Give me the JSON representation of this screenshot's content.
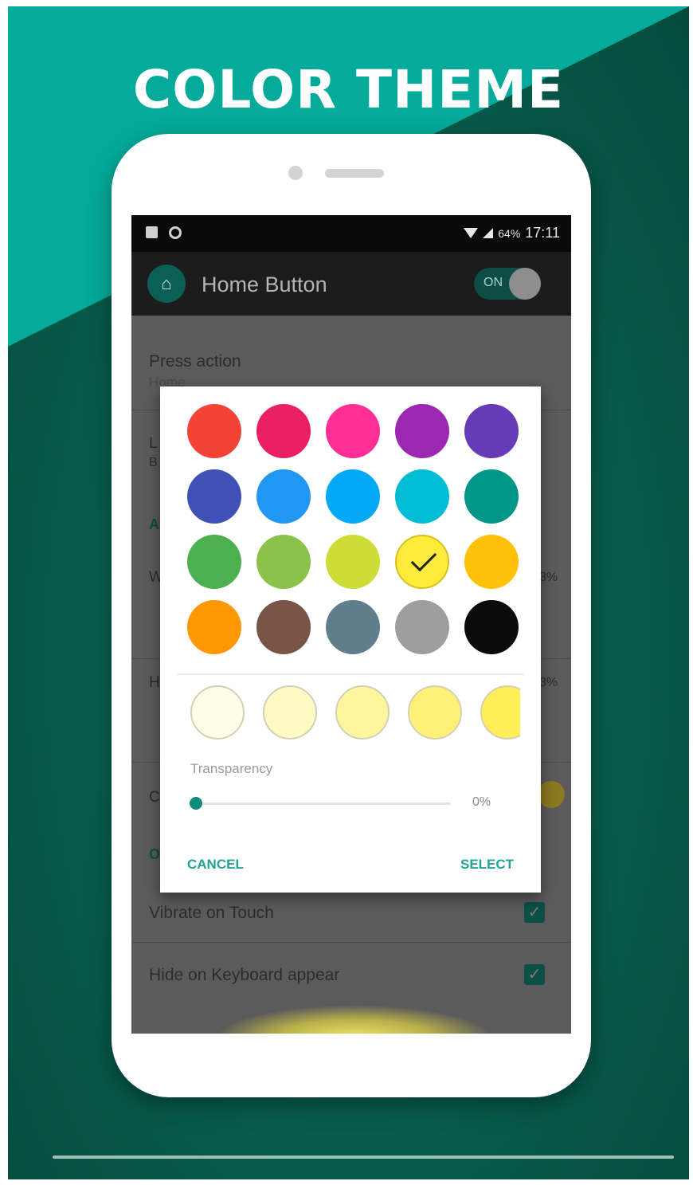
{
  "banner": {
    "title": "COLOR THEME"
  },
  "status_bar": {
    "battery": "64%",
    "time": "17:11"
  },
  "app_bar": {
    "title": "Home Button",
    "toggle_label": "ON",
    "toggle_on": true
  },
  "settings_background": {
    "press_action_label": "Press action",
    "press_action_value": "Home",
    "vibrate_label": "Vibrate on Touch",
    "vibrate_checked": true,
    "hide_keyboard_label": "Hide on Keyboard appear",
    "hide_keyboard_checked": true,
    "fragments": {
      "row2_letter": "L",
      "row2_sub_letter": "B",
      "section_letter": "A",
      "row3_letter": "W",
      "row3_value": "3%",
      "row4_letter": "H",
      "row4_value": "3%",
      "row5_letter": "C",
      "section2_letter": "O"
    }
  },
  "color_picker": {
    "palette": [
      "#f44336",
      "#e91e63",
      "#ff2d96",
      "#9c27b0",
      "#673ab7",
      "#3f51b5",
      "#2196f3",
      "#03a9f4",
      "#00bcd4",
      "#009688",
      "#4caf50",
      "#8bc34a",
      "#cddc39",
      "#ffeb3b",
      "#ffc107",
      "#ff9800",
      "#795548",
      "#607d8b",
      "#9e9e9e",
      "#0b0b0b"
    ],
    "selected_index": 13,
    "shades": [
      "#fffde7",
      "#fff9c4",
      "#fff59d",
      "#fff176",
      "#ffee58"
    ],
    "transparency_label": "Transparency",
    "transparency_value": "0%",
    "transparency_fraction": 0,
    "cancel_label": "CANCEL",
    "select_label": "SELECT"
  },
  "colors": {
    "accent": "#23a394",
    "banner_top": "#04ab9a",
    "banner_bottom": "#044a3d"
  }
}
